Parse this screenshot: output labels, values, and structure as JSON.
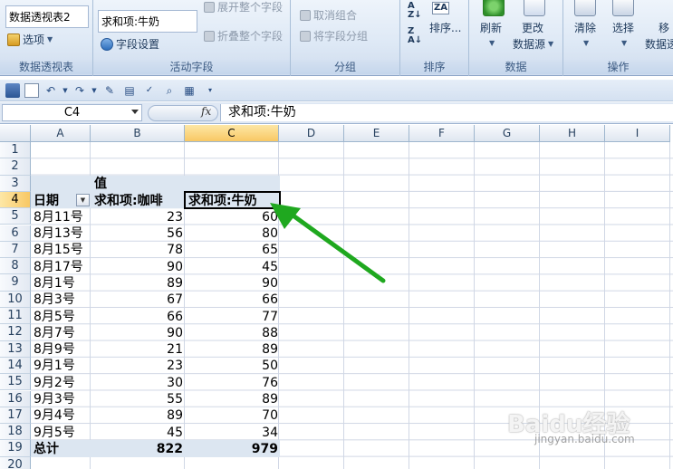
{
  "ribbon": {
    "pivot_group": {
      "name_value": "数据透视表2",
      "options_label": "选项",
      "group_label": "数据透视表"
    },
    "active_field_group": {
      "field_value": "求和项:牛奶",
      "field_settings_label": "字段设置",
      "expand_label": "展开整个字段",
      "collapse_label": "折叠整个字段",
      "group_label": "活动字段"
    },
    "grouping_group": {
      "ungroup_label": "取消组合",
      "group_field_label": "将字段分组",
      "group_label": "分组"
    },
    "sort_group": {
      "sort_label": "排序...",
      "group_label": "排序"
    },
    "data_group": {
      "refresh_label": "刷新",
      "change_source_label_1": "更改",
      "change_source_label_2": "数据源",
      "group_label": "数据"
    },
    "actions_group": {
      "clear_label": "清除",
      "select_label": "选择",
      "move_label": "移",
      "move_label_2": "数据透",
      "group_label": "操作"
    }
  },
  "formula_bar": {
    "name_box": "C4",
    "fx": "fx",
    "formula": "求和项:牛奶"
  },
  "columns": [
    "A",
    "B",
    "C",
    "D",
    "E",
    "F",
    "G",
    "H",
    "I"
  ],
  "selected_column": "C",
  "rows": [
    "1",
    "2",
    "3",
    "4",
    "5",
    "6",
    "7",
    "8",
    "9",
    "10",
    "11",
    "12",
    "13",
    "14",
    "15",
    "16",
    "17",
    "18",
    "19",
    "20"
  ],
  "selected_row": "4",
  "pivot": {
    "values_header": "值",
    "date_header": "日期",
    "coffee_header": "求和项:咖啡",
    "milk_header": "求和项:牛奶",
    "records": [
      {
        "date": "8月11号",
        "coffee": "23",
        "milk": "60"
      },
      {
        "date": "8月13号",
        "coffee": "56",
        "milk": "80"
      },
      {
        "date": "8月15号",
        "coffee": "78",
        "milk": "65"
      },
      {
        "date": "8月17号",
        "coffee": "90",
        "milk": "45"
      },
      {
        "date": "8月1号",
        "coffee": "89",
        "milk": "90"
      },
      {
        "date": "8月3号",
        "coffee": "67",
        "milk": "66"
      },
      {
        "date": "8月5号",
        "coffee": "66",
        "milk": "77"
      },
      {
        "date": "8月7号",
        "coffee": "90",
        "milk": "88"
      },
      {
        "date": "8月9号",
        "coffee": "21",
        "milk": "89"
      },
      {
        "date": "9月1号",
        "coffee": "23",
        "milk": "50"
      },
      {
        "date": "9月2号",
        "coffee": "30",
        "milk": "76"
      },
      {
        "date": "9月3号",
        "coffee": "55",
        "milk": "89"
      },
      {
        "date": "9月4号",
        "coffee": "89",
        "milk": "70"
      },
      {
        "date": "9月5号",
        "coffee": "45",
        "milk": "34"
      }
    ],
    "total_label": "总计",
    "total_coffee": "822",
    "total_milk": "979"
  },
  "annotation": {
    "arrow_color": "#1fa81f"
  },
  "watermark": {
    "brand": "Baidu经验",
    "site": "jingyan.baidu.com"
  },
  "colors": {
    "pivot_band": "#dce6f1",
    "selection": "#f8c864"
  }
}
